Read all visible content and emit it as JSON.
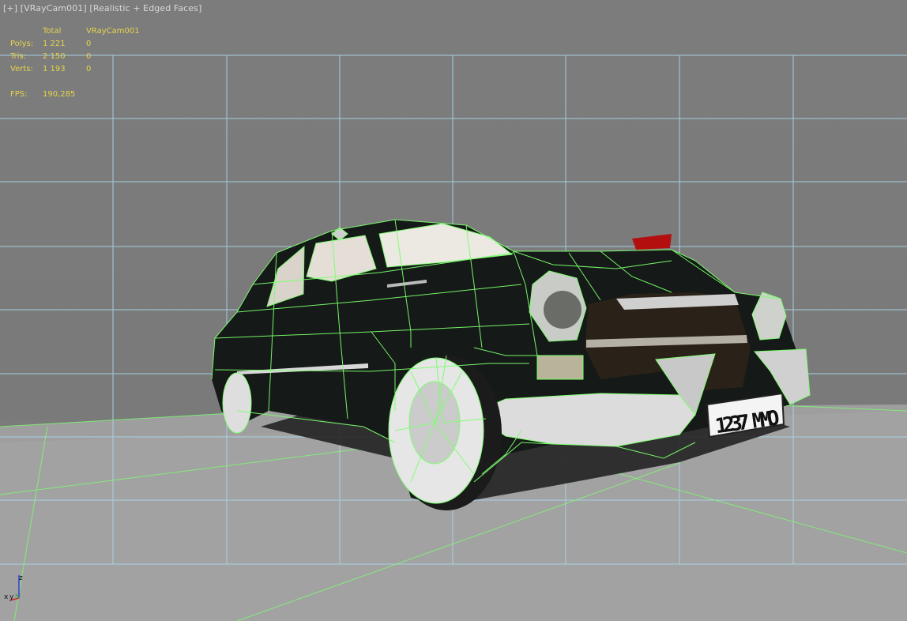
{
  "viewport": {
    "label_plus": "[+]",
    "label_camera": "[VRayCam001]",
    "label_shading": "[Realistic + Edged Faces]"
  },
  "stats": {
    "header_total": "Total",
    "header_object": "VRayCam001",
    "rows": [
      {
        "label": "Polys:",
        "total": "1 221",
        "object": "0"
      },
      {
        "label": "Tris:",
        "total": "2 150",
        "object": "0"
      },
      {
        "label": "Verts:",
        "total": "1 193",
        "object": "0"
      }
    ],
    "fps_label": "FPS:",
    "fps_value": "190,285"
  },
  "scene": {
    "license_plate": "1237 MMO",
    "grid_color": "#a9d8ea",
    "wire_color": "#7cff6e",
    "car_body_color": "#151917"
  },
  "axis": {
    "z": "z",
    "x": "x",
    "y": "y"
  }
}
